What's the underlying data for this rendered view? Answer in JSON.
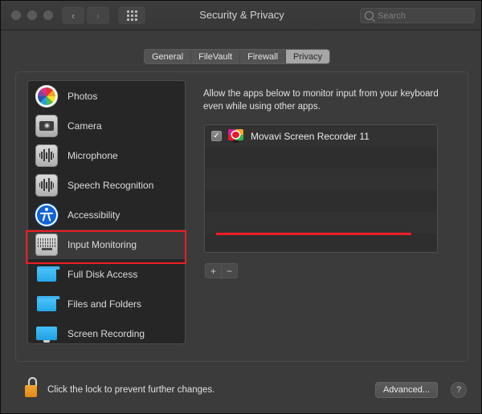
{
  "window": {
    "title": "Security & Privacy",
    "traffic_lights": [
      "close",
      "minimize",
      "maximize"
    ],
    "nav_back_icon": "chevron-left-icon",
    "nav_forward_icon": "chevron-right-icon",
    "grid_icon": "show-all-grid-icon",
    "back_glyph": "‹",
    "forward_glyph": "›"
  },
  "search": {
    "placeholder": "Search",
    "icon": "search-icon"
  },
  "tabs": [
    {
      "label": "General",
      "selected": false
    },
    {
      "label": "FileVault",
      "selected": false
    },
    {
      "label": "Firewall",
      "selected": false
    },
    {
      "label": "Privacy",
      "selected": true
    }
  ],
  "sidebar": {
    "items": [
      {
        "label": "Photos",
        "icon": "photos-icon",
        "selected": false
      },
      {
        "label": "Camera",
        "icon": "camera-icon",
        "selected": false
      },
      {
        "label": "Microphone",
        "icon": "microphone-icon",
        "selected": false
      },
      {
        "label": "Speech Recognition",
        "icon": "speech-recognition-icon",
        "selected": false
      },
      {
        "label": "Accessibility",
        "icon": "accessibility-icon",
        "selected": false
      },
      {
        "label": "Input Monitoring",
        "icon": "keyboard-icon",
        "selected": true
      },
      {
        "label": "Full Disk Access",
        "icon": "folder-icon",
        "selected": false
      },
      {
        "label": "Files and Folders",
        "icon": "folder-icon",
        "selected": false
      },
      {
        "label": "Screen Recording",
        "icon": "display-icon",
        "selected": false
      }
    ]
  },
  "panel": {
    "description": "Allow the apps below to monitor input from your keyboard even while using other apps.",
    "apps": [
      {
        "name": "Movavi Screen Recorder 11",
        "checked": true,
        "check_glyph": "✓",
        "icon": "movavi-screen-recorder-icon"
      }
    ],
    "add_label": "+",
    "remove_label": "−"
  },
  "footer": {
    "lock_icon": "unlocked-padlock-icon",
    "lock_text": "Click the lock to prevent further changes.",
    "advanced_label": "Advanced...",
    "help_label": "?"
  },
  "annotations": {
    "highlight_color": "#ee1c25",
    "highlighted_sidebar_item": "Input Monitoring",
    "underlined_app": "Movavi Screen Recorder 11"
  }
}
